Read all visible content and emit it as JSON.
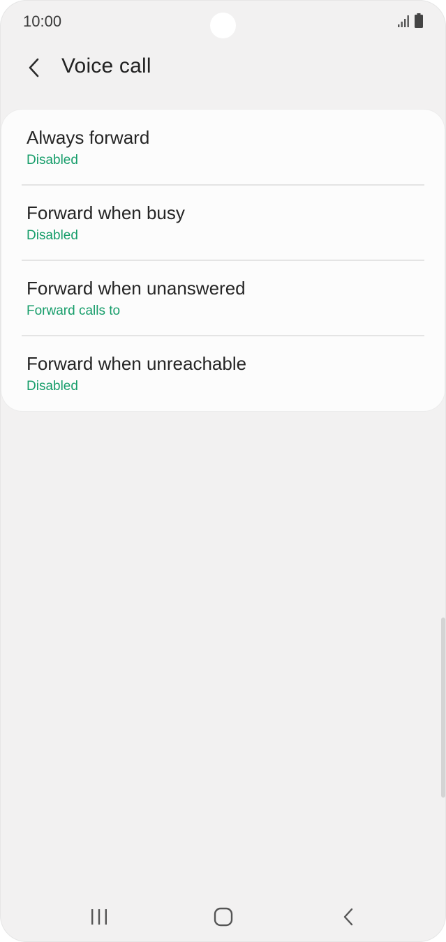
{
  "status_bar": {
    "time": "10:00",
    "signal_icon": "signal-icon",
    "battery_icon": "battery-icon"
  },
  "header": {
    "back_icon": "chevron-left-icon",
    "title": "Voice call"
  },
  "items": [
    {
      "title": "Always forward",
      "subtitle": "Disabled"
    },
    {
      "title": "Forward when busy",
      "subtitle": "Disabled"
    },
    {
      "title": "Forward when unanswered",
      "subtitle": "Forward calls to"
    },
    {
      "title": "Forward when unreachable",
      "subtitle": "Disabled"
    }
  ],
  "nav_bar": {
    "recents_icon": "recents-icon",
    "home_icon": "home-icon",
    "back_icon": "back-icon"
  },
  "colors": {
    "accent": "#169d6a",
    "background": "#f2f1f1",
    "card": "#fcfcfc",
    "text": "#252525"
  }
}
